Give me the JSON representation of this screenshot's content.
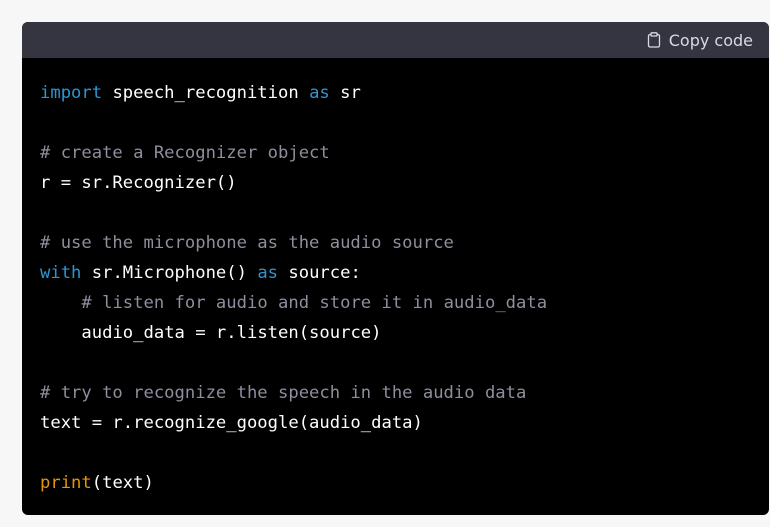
{
  "header": {
    "copy_label": "Copy code"
  },
  "colors": {
    "background": "#000000",
    "header": "#343541",
    "keyword": "#2e95d3",
    "comment": "#8e8e9e",
    "builtin": "#e9950c",
    "text": "#ffffff"
  },
  "code": {
    "line1": {
      "kw1": "import",
      "t1": " speech_recognition ",
      "kw2": "as",
      "t2": " sr"
    },
    "line3": {
      "comment": "# create a Recognizer object"
    },
    "line4": {
      "t1": "r = sr.Recognizer()"
    },
    "line6": {
      "comment": "# use the microphone as the audio source"
    },
    "line7": {
      "kw1": "with",
      "t1": " sr.Microphone() ",
      "kw2": "as",
      "t2": " source:"
    },
    "line8": {
      "indent": "    ",
      "comment": "# listen for audio and store it in audio_data"
    },
    "line9": {
      "indent": "    ",
      "t1": "audio_data = r.listen(source)"
    },
    "line11": {
      "comment": "# try to recognize the speech in the audio data"
    },
    "line12": {
      "t1": "text = r.recognize_google(audio_data)"
    },
    "line14": {
      "fn": "print",
      "t1": "(text)"
    }
  }
}
